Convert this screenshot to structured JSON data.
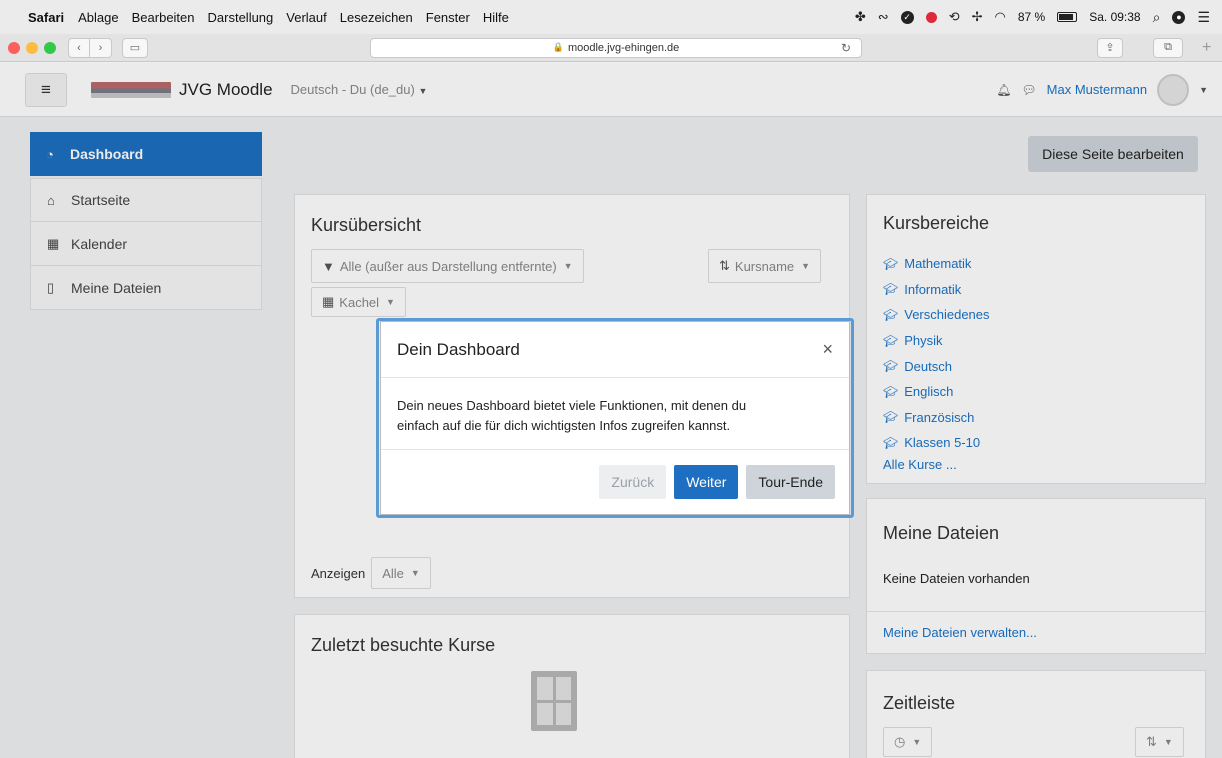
{
  "mac_menubar": {
    "app": "Safari",
    "items": [
      "Ablage",
      "Bearbeiten",
      "Darstellung",
      "Verlauf",
      "Lesezeichen",
      "Fenster",
      "Hilfe"
    ],
    "battery": "87 %",
    "clock": "Sa. 09:38"
  },
  "browser": {
    "url": "moodle.jvg-ehingen.de"
  },
  "navbar": {
    "site_title": "JVG Moodle",
    "language": "Deutsch - Du (de_du)",
    "user_name": "Max Mustermann"
  },
  "drawer": {
    "items": [
      {
        "label": "Dashboard",
        "icon": "dashboard-icon"
      },
      {
        "label": "Startseite",
        "icon": "home-icon"
      },
      {
        "label": "Kalender",
        "icon": "calendar-icon"
      },
      {
        "label": "Meine Dateien",
        "icon": "file-icon"
      }
    ]
  },
  "page": {
    "edit_button": "Diese Seite bearbeiten"
  },
  "course_overview": {
    "title": "Kursübersicht",
    "filter": "Alle (außer aus Darstellung entfernte)",
    "sort": "Kursname",
    "view": "Kachel",
    "show_label": "Anzeigen",
    "show_value": "Alle"
  },
  "recent_courses": {
    "title": "Zuletzt besuchte Kurse"
  },
  "course_areas": {
    "title": "Kursbereiche",
    "items": [
      "Mathematik",
      "Informatik",
      "Verschiedenes",
      "Physik",
      "Deutsch",
      "Englisch",
      "Französisch",
      "Klassen 5-10"
    ],
    "all_courses": "Alle Kurse ..."
  },
  "my_files": {
    "title": "Meine Dateien",
    "empty": "Keine Dateien vorhanden",
    "manage": "Meine Dateien verwalten..."
  },
  "timeline": {
    "title": "Zeitleiste"
  },
  "tour_modal": {
    "title": "Dein Dashboard",
    "close": "×",
    "body_line1": "Dein neues Dashboard bietet viele Funktionen, mit denen du",
    "body_line2": "einfach auf die für dich wichtigsten Infos zugreifen kannst.",
    "back": "Zurück",
    "next": "Weiter",
    "end": "Tour-Ende"
  },
  "colors": {
    "primary": "#1e6fc1",
    "link": "#1a73c8",
    "focus_ring": "#5b9bd5"
  }
}
